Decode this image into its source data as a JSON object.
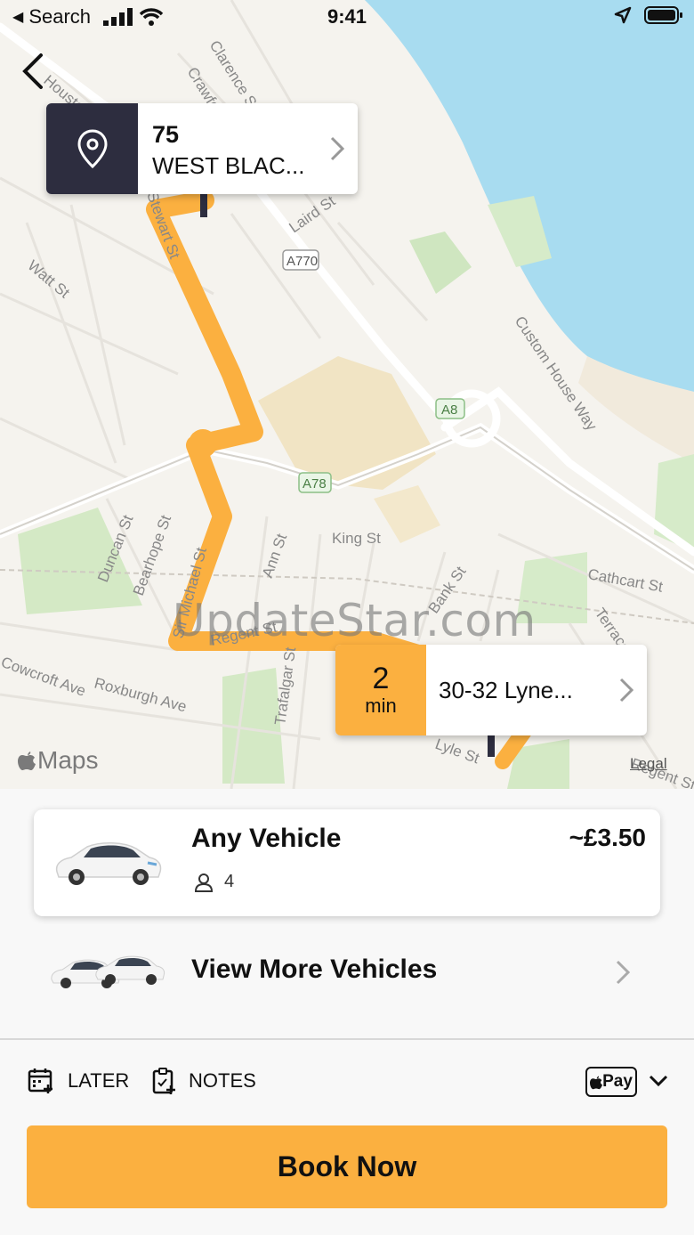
{
  "status_bar": {
    "back_app": "Search",
    "time": "9:41"
  },
  "map": {
    "pickup": {
      "line1": "75",
      "line2": "WEST BLAC..."
    },
    "destination": {
      "eta_value": "2",
      "eta_unit": "min",
      "address": "30-32 Lyne..."
    },
    "street_labels": [
      "Clarence St",
      "Crawford",
      "Houston",
      "Stewart St",
      "Laird St",
      "A770",
      "Watt St",
      "Custom House Way",
      "A8",
      "A78",
      "King St",
      "Duncan St",
      "Bearhope St",
      "Ann St",
      "Sir Michael St",
      "Cathcart St",
      "Bank St",
      "Terrace",
      "Regent St",
      "Trafalgar St",
      "Roxburgh Ave",
      "Cowcroft Ave",
      "Lyle St",
      "Regent St"
    ],
    "watermark": "UpdateStar.com",
    "maps_label": "Maps",
    "legal_label": "Legal"
  },
  "vehicle": {
    "name": "Any Vehicle",
    "price": "~£3.50",
    "seats": "4"
  },
  "more_vehicles": {
    "label": "View More Vehicles"
  },
  "options": {
    "later": "LATER",
    "notes": "NOTES",
    "payment": "Pay"
  },
  "book_button": "Book Now",
  "colors": {
    "accent": "#fbb040",
    "pickup_dark": "#2d2d3f",
    "water": "#a8dcf0"
  }
}
